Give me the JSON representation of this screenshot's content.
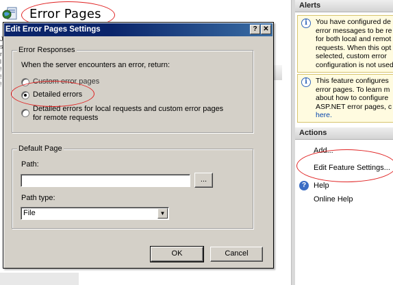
{
  "page": {
    "title": "Error Pages"
  },
  "dialog": {
    "title": "Edit Error Pages Settings",
    "help_button": "?",
    "close_button": "✕",
    "error_responses": {
      "legend": "Error Responses",
      "prompt": "When the server encounters an error, return:",
      "options": [
        {
          "label": "Custom error pages",
          "checked": false
        },
        {
          "label": "Detailed errors",
          "checked": true
        },
        {
          "label_line1": "Detailed errors for local requests and custom error pages",
          "label_line2": "for remote requests",
          "checked": false
        }
      ]
    },
    "default_page": {
      "legend": "Default Page",
      "path_label": "Path:",
      "path_value": "",
      "browse_button": "...",
      "path_type_label": "Path type:",
      "path_type_value": "File"
    },
    "ok_button": "OK",
    "cancel_button": "Cancel"
  },
  "right_pane": {
    "alerts_header": "Alerts",
    "alert1_lines": [
      "You have configured de",
      "error messages to be re",
      "for both local and remot",
      "requests. When this opt",
      "selected, custom error",
      "configuration is not used"
    ],
    "alert2_lines": [
      "This feature configures",
      "error pages. To learn m",
      "about how to configure",
      "ASP.NET error pages, c",
      "here."
    ],
    "actions_header": "Actions",
    "actions": [
      "Add...",
      "Edit Feature Settings...",
      "Help",
      "Online Help"
    ]
  },
  "colors": {
    "annotation": "#e02020",
    "titlebar": "#0a246a",
    "dialog_face": "#d4d0c8"
  },
  "icons": [
    "iis-page-icon",
    "info-icon",
    "help-icon",
    "close-icon",
    "dropdown-arrow-icon",
    "radio-icon"
  ]
}
